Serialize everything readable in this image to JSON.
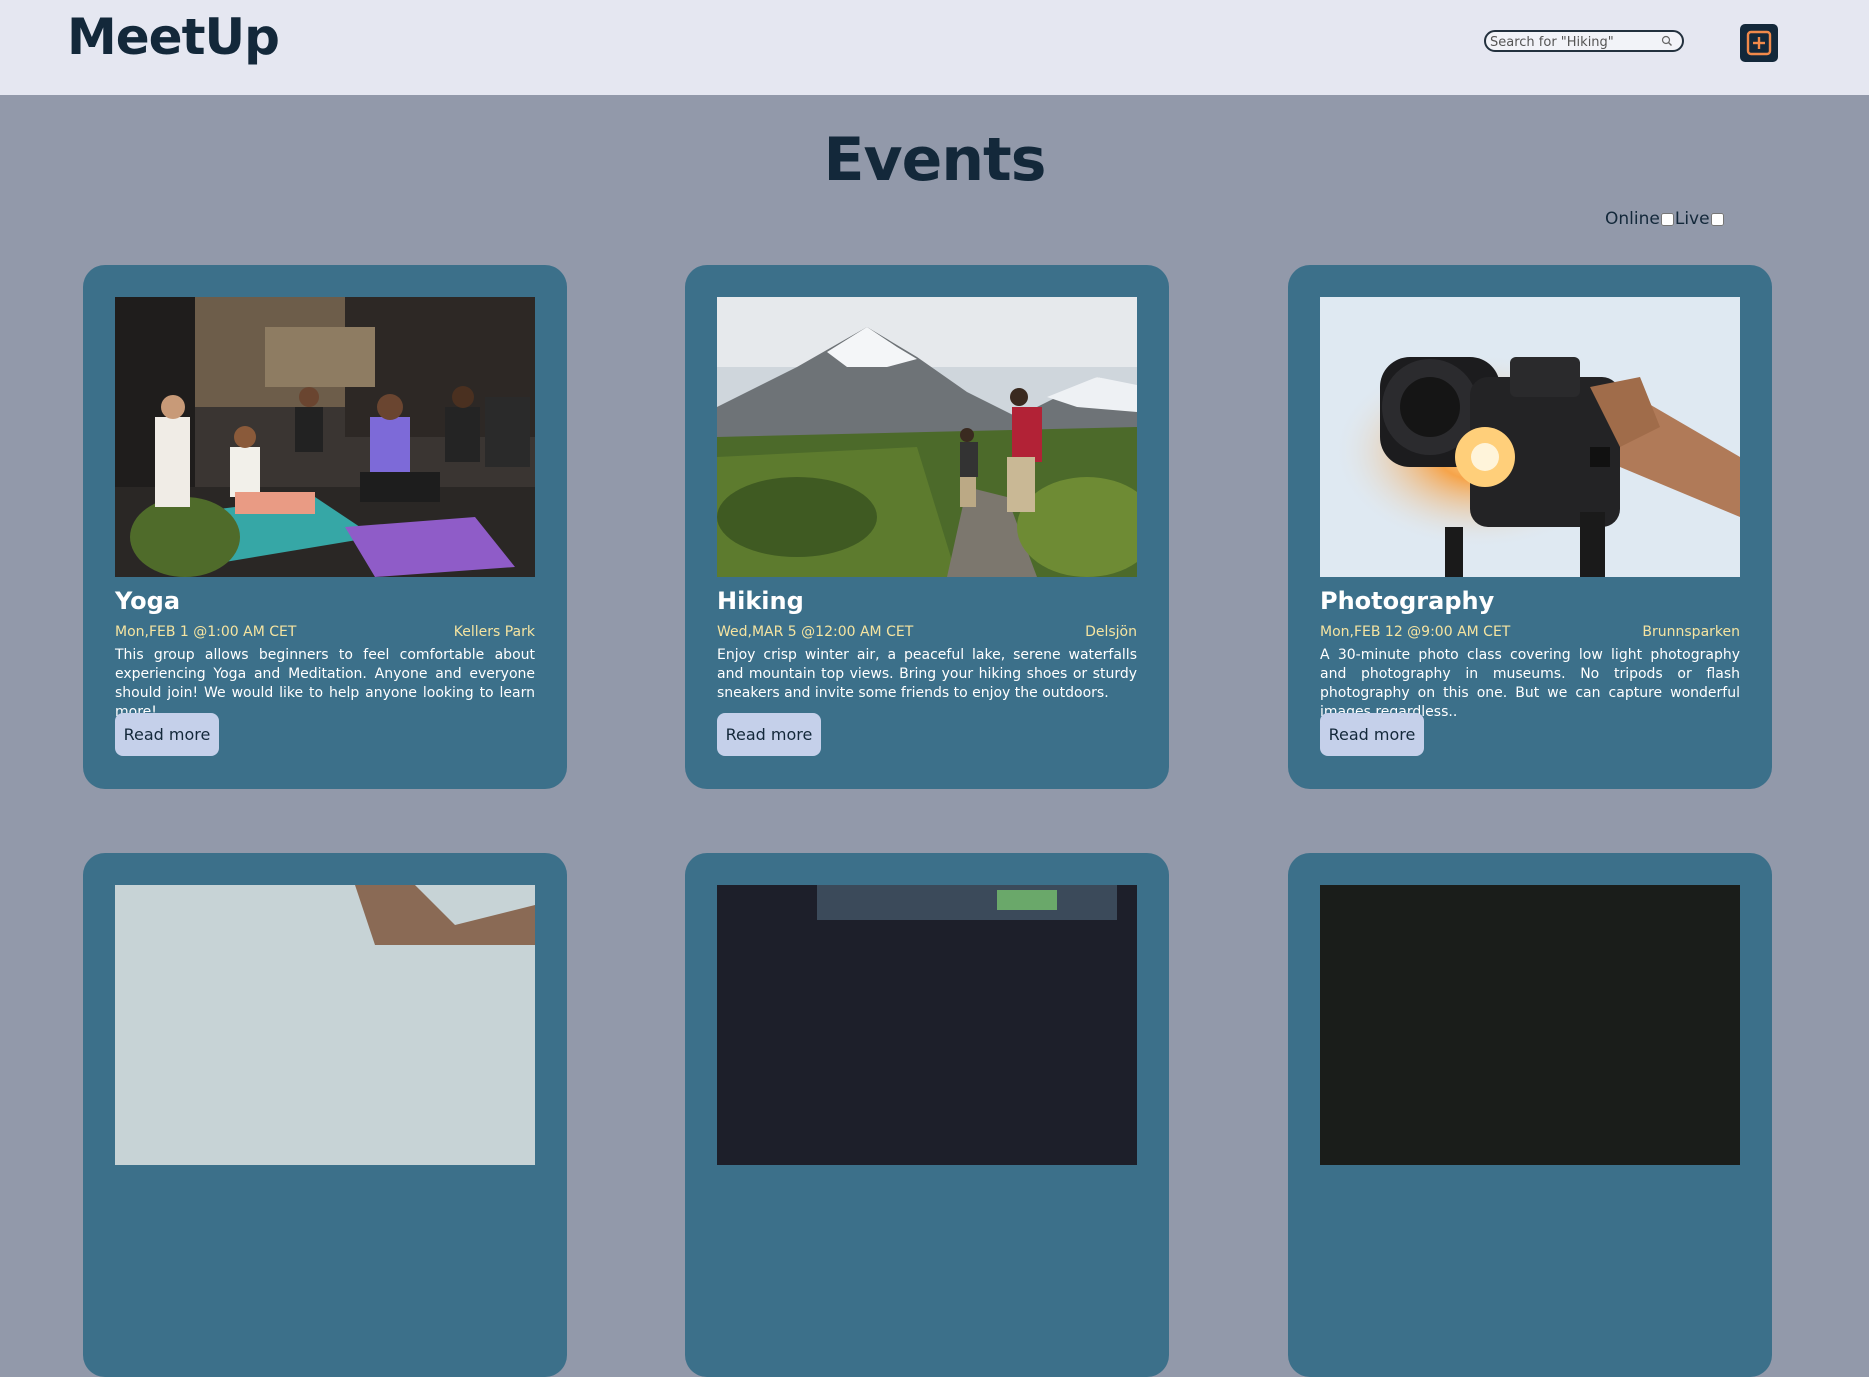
{
  "header": {
    "logo": "MeetUp",
    "search_placeholder": "Search for \"Hiking\"",
    "search_icon": "search-icon",
    "add_icon": "plus-square-icon",
    "accent": "#f0894a"
  },
  "main": {
    "title": "Events",
    "filters": [
      {
        "label": "Online",
        "checked": false
      },
      {
        "label": "Live",
        "checked": false
      }
    ]
  },
  "events": [
    {
      "name": "Yoga",
      "date": "Mon,FEB 1 @1:00 AM CET",
      "location": "Kellers Park",
      "description": "This group allows beginners to feel comfortable about experiencing Yoga and Meditation. Anyone and everyone should join! We would like to help anyone looking to learn more!",
      "button": "Read more"
    },
    {
      "name": "Hiking",
      "date": "Wed,MAR 5 @12:00 AM CET",
      "location": "Delsjön",
      "description": "Enjoy crisp winter air, a peaceful lake, serene waterfalls and mountain top views. Bring your hiking shoes or sturdy sneakers and invite some friends to enjoy the outdoors.",
      "button": "Read more"
    },
    {
      "name": "Photography",
      "date": "Mon,FEB 12 @9:00 AM CET",
      "location": "Brunnsparken",
      "description": "A 30-minute photo class covering low light photography and photography in museums. No tripods or flash photography on this one. But we can capture wonderful images regardless..",
      "button": "Read more"
    }
  ],
  "colors": {
    "page_bg": "#9299aa",
    "header_bg": "#e5e7f1",
    "card_bg": "#3c708a",
    "date_text": "#f5e4a1",
    "button_bg": "#c5d0ea",
    "title_text": "#13283a"
  }
}
